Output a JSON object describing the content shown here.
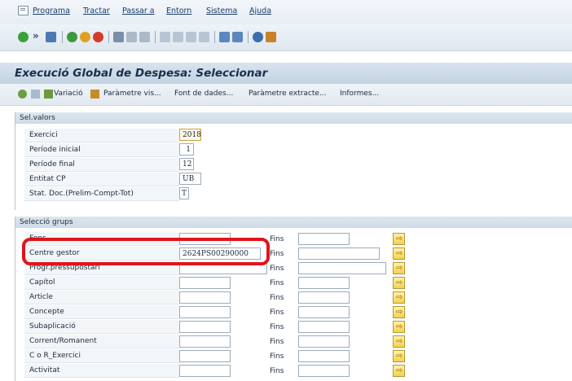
{
  "menu": {
    "items": [
      "Programa",
      "Tractar",
      "Passar a",
      "Entorn",
      "Sistema",
      "Ajuda"
    ]
  },
  "title": "Execució Global de Despesa: Seleccionar",
  "app_toolbar": {
    "variacio": "Variació",
    "param_vis": "Paràmetre vis...",
    "font_dades": "Font de dades...",
    "param_extracte": "Paràmetre extracte...",
    "informes": "Informes..."
  },
  "selvalors": {
    "header": "Sel.valors",
    "rows": [
      {
        "label": "Exercici",
        "value": "2018"
      },
      {
        "label": "Període inicial",
        "value": "1"
      },
      {
        "label": "Període final",
        "value": "12"
      },
      {
        "label": "Entitat CP",
        "value": "UB"
      },
      {
        "label": "Stat. Doc.(Prelim-Compt-Tot)",
        "value": "T"
      }
    ]
  },
  "seleccio": {
    "header": "Selecció grups",
    "fins_label": "Fins",
    "rows": [
      {
        "label": "Fons",
        "value": ""
      },
      {
        "label": "Centre gestor",
        "value": "2624PS00290000"
      },
      {
        "label": "Progr.pressupostari",
        "value": ""
      },
      {
        "label": "Capítol",
        "value": ""
      },
      {
        "label": "Article",
        "value": ""
      },
      {
        "label": "Concepte",
        "value": ""
      },
      {
        "label": "Subaplicació",
        "value": ""
      },
      {
        "label": "Corrent/Romanent",
        "value": ""
      },
      {
        "label": "C o R_Exercici",
        "value": ""
      },
      {
        "label": "Activitat",
        "value": ""
      }
    ]
  },
  "colors": {
    "highlight": "#e1141b",
    "title_bar": "#c4d3e2",
    "selection_button": "#f2d24f"
  }
}
